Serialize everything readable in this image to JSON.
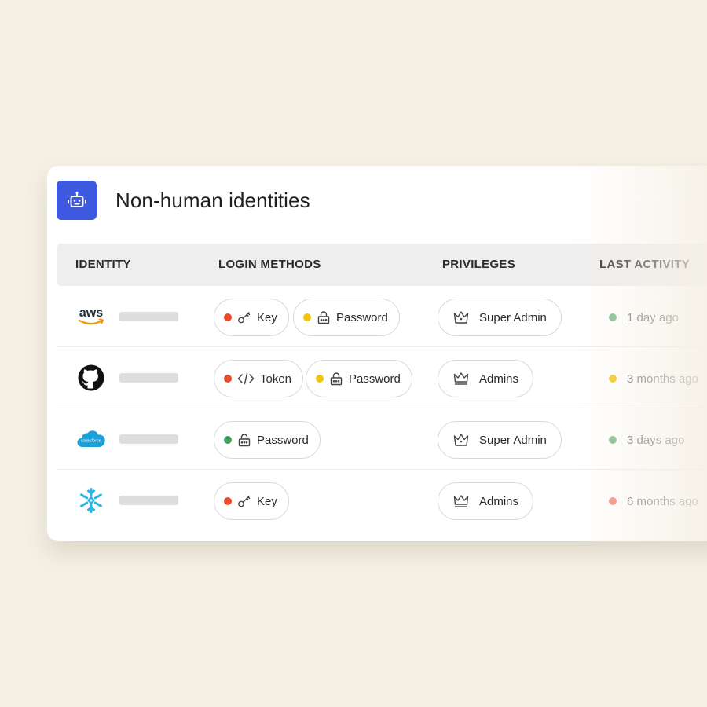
{
  "panel": {
    "title": "Non-human identities",
    "icon": "robot-icon",
    "accent": "#3d59e0"
  },
  "columns": {
    "identity": "IDENTITY",
    "login_methods": "LOGIN METHODS",
    "privileges": "PRIVILEGES",
    "last_activity": "LAST ACTIVITY"
  },
  "status_colors": {
    "red": "#ec4b2b",
    "yellow": "#f1c40f",
    "green": "#3f9e58",
    "soft_green": "#78b98a",
    "soft_red": "#f08878"
  },
  "rows": [
    {
      "identity_logo": "aws-logo",
      "logo_text": "aws",
      "methods": [
        {
          "label": "Key",
          "icon": "key-icon",
          "status": "#ec4b2b"
        },
        {
          "label": "Password",
          "icon": "lock-icon",
          "status": "#f1c40f"
        }
      ],
      "privilege": {
        "label": "Super Admin",
        "icon": "crown-super-icon"
      },
      "activity": {
        "label": "1 day ago",
        "status": "#78b98a"
      }
    },
    {
      "identity_logo": "github-logo",
      "methods": [
        {
          "label": "Token",
          "icon": "code-icon",
          "status": "#ec4b2b"
        },
        {
          "label": "Password",
          "icon": "lock-icon",
          "status": "#f1c40f"
        }
      ],
      "privilege": {
        "label": "Admins",
        "icon": "crown-icon"
      },
      "activity": {
        "label": "3 months ago",
        "status": "#f1c40f"
      }
    },
    {
      "identity_logo": "salesforce-logo",
      "logo_text": "salesforce",
      "methods": [
        {
          "label": "Password",
          "icon": "lock-icon",
          "status": "#3f9e58"
        }
      ],
      "privilege": {
        "label": "Super Admin",
        "icon": "crown-super-icon"
      },
      "activity": {
        "label": "3 days ago",
        "status": "#78b98a"
      }
    },
    {
      "identity_logo": "snowflake-logo",
      "methods": [
        {
          "label": "Key",
          "icon": "key-icon",
          "status": "#ec4b2b"
        }
      ],
      "privilege": {
        "label": "Admins",
        "icon": "crown-icon"
      },
      "activity": {
        "label": "6 months ago",
        "status": "#f08878"
      }
    }
  ]
}
